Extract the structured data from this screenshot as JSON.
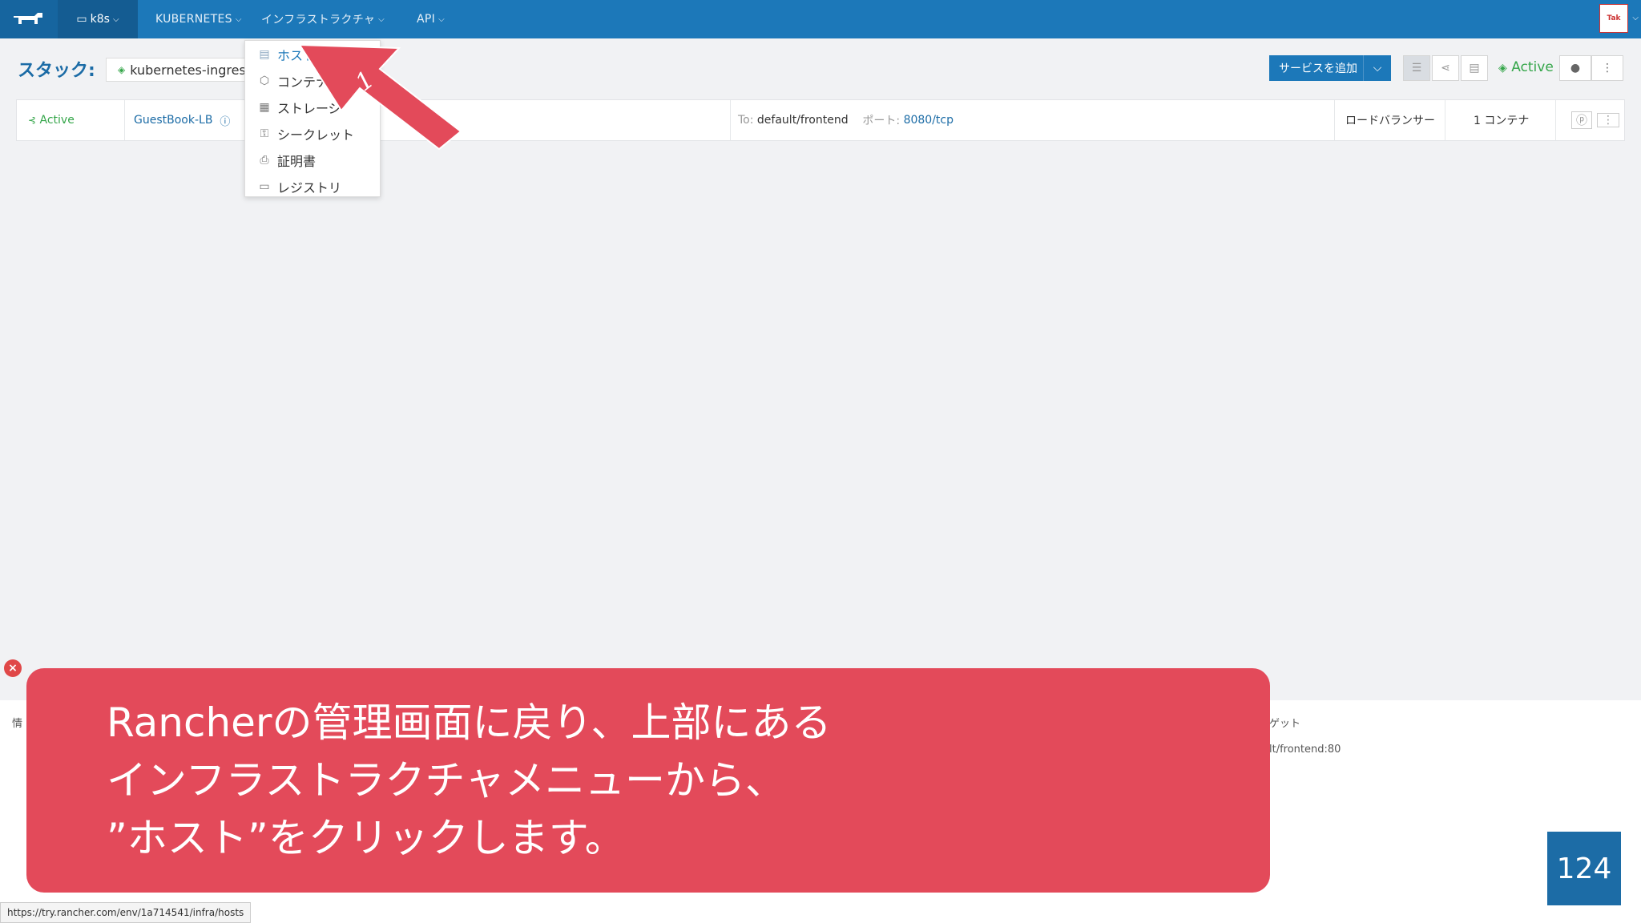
{
  "nav": {
    "environment": "k8s",
    "items": [
      {
        "label": "KUBERNETES"
      },
      {
        "label": "インフラストラクチャ"
      },
      {
        "label": "API"
      }
    ],
    "avatar_text": "Tak"
  },
  "stack": {
    "label": "スタック:",
    "selected": "kubernetes-ingress-"
  },
  "toolbar": {
    "add_service_label": "サービスを追加",
    "state_label": "Active"
  },
  "service_row": {
    "state": "Active",
    "name": "GuestBook-LB",
    "target_prefix": "To:",
    "target": "default/frontend",
    "port_prefix": "ポート:",
    "port": "8080/tcp",
    "kind": "ロードバランサー",
    "containers": "1 コンテナ"
  },
  "menu": {
    "items": [
      {
        "label": "ホスト",
        "icon": "host-icon"
      },
      {
        "label": "コンテナ",
        "icon": "container-icon"
      },
      {
        "label": "ストレージ",
        "icon": "storage-icon"
      },
      {
        "label": "シークレット",
        "icon": "secret-icon"
      },
      {
        "label": "証明書",
        "icon": "certificate-icon"
      },
      {
        "label": "レジストリ",
        "icon": "registry-icon"
      }
    ]
  },
  "annotation": {
    "step_number": "1"
  },
  "bottom": {
    "frag_info": "情",
    "frag_target": "ゲット",
    "frag_link": "lt/frontend:80"
  },
  "status_url": "https://try.rancher.com/env/1a714541/infra/hosts",
  "caption": {
    "line1": "Rancherの管理画面に戻り、上部にある",
    "line2": "インフラストラクチャメニューから、",
    "line3": "”ホスト”をクリックします。"
  },
  "page_number": "124",
  "colors": {
    "nav_bg": "#1c78b9",
    "accent_red": "#e34a5a",
    "active_green": "#35a64a"
  }
}
